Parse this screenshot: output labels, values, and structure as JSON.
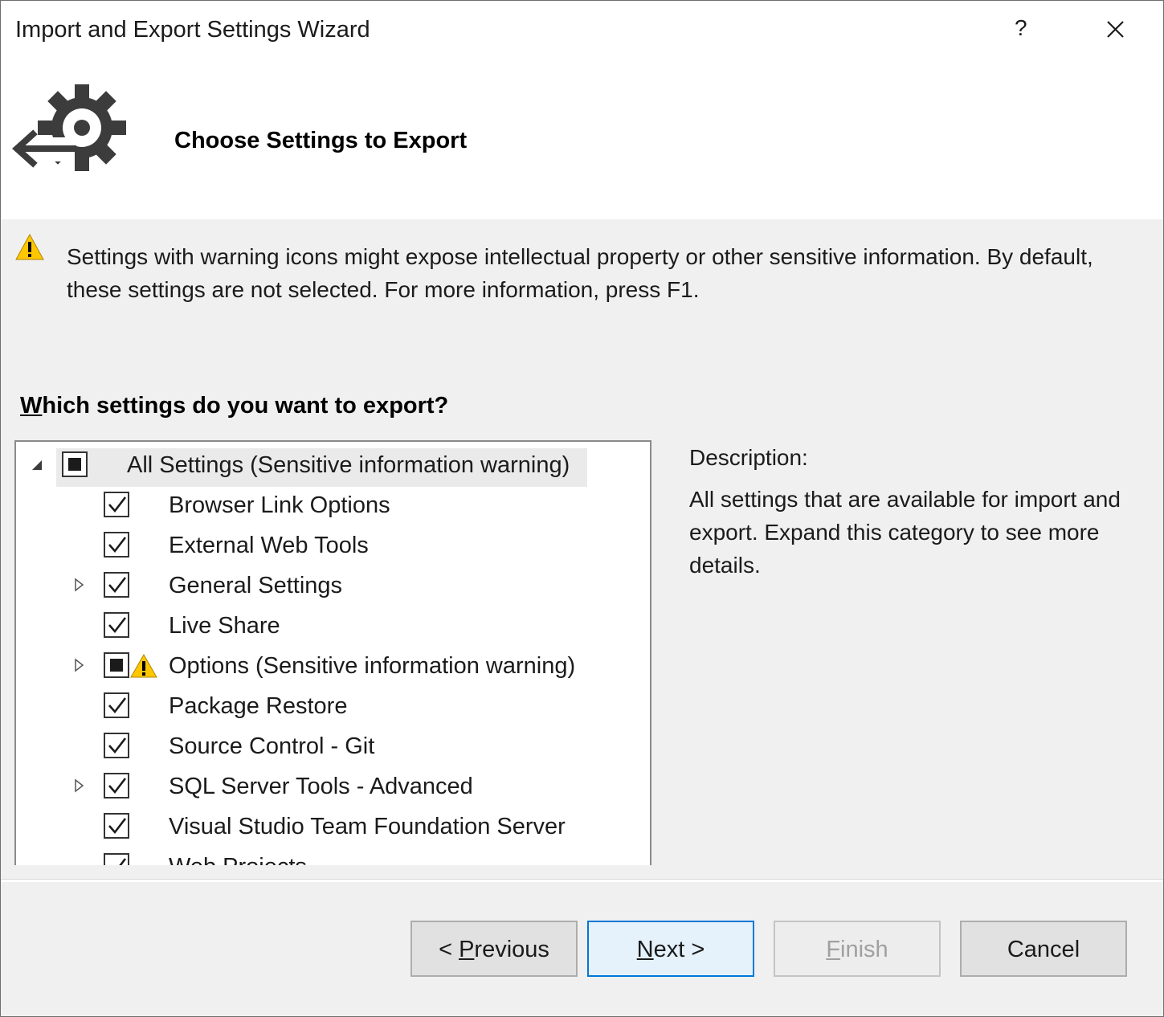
{
  "window": {
    "title": "Import and Export Settings Wizard",
    "help_label": "?"
  },
  "header": {
    "heading": "Choose Settings to Export",
    "icon": "export-settings-gear-icon"
  },
  "warning": {
    "icon": "warning-icon",
    "text": "Settings with warning icons might expose intellectual property or other sensitive information. By default, these settings are not selected. For more information, press F1."
  },
  "question": {
    "first_letter": "W",
    "rest": "hich settings do you want to export?"
  },
  "tree": {
    "items": [
      {
        "label": "All Settings (Sensitive information warning)",
        "state": "indeterminate",
        "expander": "expanded",
        "level": 0,
        "warning": false,
        "selected": true
      },
      {
        "label": "Browser Link Options",
        "state": "checked",
        "expander": "none",
        "level": 1,
        "warning": false
      },
      {
        "label": "External Web Tools",
        "state": "checked",
        "expander": "none",
        "level": 1,
        "warning": false
      },
      {
        "label": "General Settings",
        "state": "checked",
        "expander": "collapsed",
        "level": 1,
        "warning": false
      },
      {
        "label": "Live Share",
        "state": "checked",
        "expander": "none",
        "level": 1,
        "warning": false
      },
      {
        "label": "Options (Sensitive information warning)",
        "state": "indeterminate",
        "expander": "collapsed",
        "level": 1,
        "warning": true
      },
      {
        "label": "Package Restore",
        "state": "checked",
        "expander": "none",
        "level": 1,
        "warning": false
      },
      {
        "label": "Source Control - Git",
        "state": "checked",
        "expander": "none",
        "level": 1,
        "warning": false
      },
      {
        "label": "SQL Server Tools - Advanced",
        "state": "checked",
        "expander": "collapsed",
        "level": 1,
        "warning": false
      },
      {
        "label": "Visual Studio Team Foundation Server",
        "state": "checked",
        "expander": "none",
        "level": 1,
        "warning": false
      },
      {
        "label": "Web Projects",
        "state": "checked",
        "expander": "none",
        "level": 1,
        "warning": false
      }
    ]
  },
  "description": {
    "label": "Description:",
    "text": "All settings that are available for import and export. Expand this category to see more details."
  },
  "buttons": {
    "previous": {
      "prefix": "< ",
      "accel": "P",
      "rest": "revious"
    },
    "next": {
      "accel": "N",
      "rest": "ext >"
    },
    "finish": {
      "accel": "F",
      "rest": "inish"
    },
    "cancel": "Cancel"
  },
  "colors": {
    "accent": "#0078d7",
    "warning_yellow": "#ffc700",
    "background": "#f0f0f0"
  }
}
